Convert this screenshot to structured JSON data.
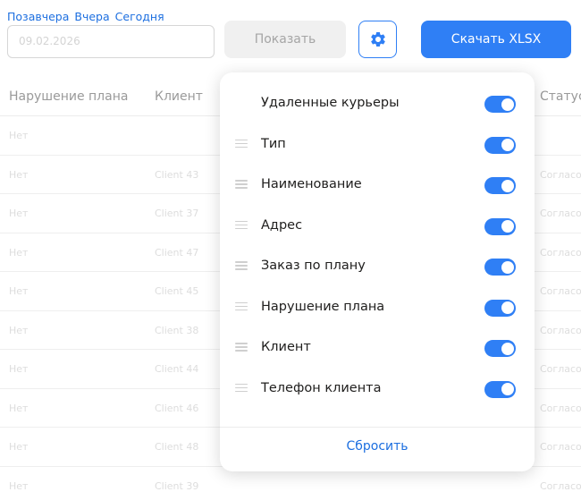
{
  "quick_dates": [
    "Позавчера",
    "Вчера",
    "Сегодня"
  ],
  "date_input": {
    "value": "09.02.2026"
  },
  "buttons": {
    "show": "Показать",
    "download": "Скачать XLSX"
  },
  "icons": {
    "settings": "gear-icon",
    "drag": "drag-handle-icon"
  },
  "colors": {
    "accent": "#2f7ff5",
    "link": "#1d6fe0"
  },
  "table": {
    "headers": {
      "plan_violation": "Нарушение плана",
      "client": "Клиент",
      "status": "Статус"
    },
    "rows": [
      {
        "violation": "Нет",
        "client": "",
        "status": ""
      },
      {
        "violation": "Нет",
        "client": "Client 43",
        "status": "Согласо"
      },
      {
        "violation": "Нет",
        "client": "Client 37",
        "status": "Согласо"
      },
      {
        "violation": "Нет",
        "client": "Client 47",
        "status": "Согласо"
      },
      {
        "violation": "Нет",
        "client": "Client 45",
        "status": "Согласо"
      },
      {
        "violation": "Нет",
        "client": "Client 38",
        "status": "Согласо"
      },
      {
        "violation": "Нет",
        "client": "Client 44",
        "status": "Согласо"
      },
      {
        "violation": "Нет",
        "client": "Client 46",
        "status": "Согласо"
      },
      {
        "violation": "Нет",
        "client": "Client 48",
        "status": "Согласо"
      },
      {
        "violation": "Нет",
        "client": "Client 39",
        "status": "Согласо"
      }
    ]
  },
  "settings_panel": {
    "items": [
      {
        "label": "Удаленные курьеры",
        "enabled": true,
        "draggable": false
      },
      {
        "label": "Тип",
        "enabled": true,
        "draggable": true
      },
      {
        "label": "Наименование",
        "enabled": true,
        "draggable": true
      },
      {
        "label": "Адрес",
        "enabled": true,
        "draggable": true
      },
      {
        "label": "Заказ по плану",
        "enabled": true,
        "draggable": true
      },
      {
        "label": "Нарушение плана",
        "enabled": true,
        "draggable": true
      },
      {
        "label": "Клиент",
        "enabled": true,
        "draggable": true
      },
      {
        "label": "Телефон клиента",
        "enabled": true,
        "draggable": true
      }
    ],
    "reset_label": "Сбросить"
  }
}
